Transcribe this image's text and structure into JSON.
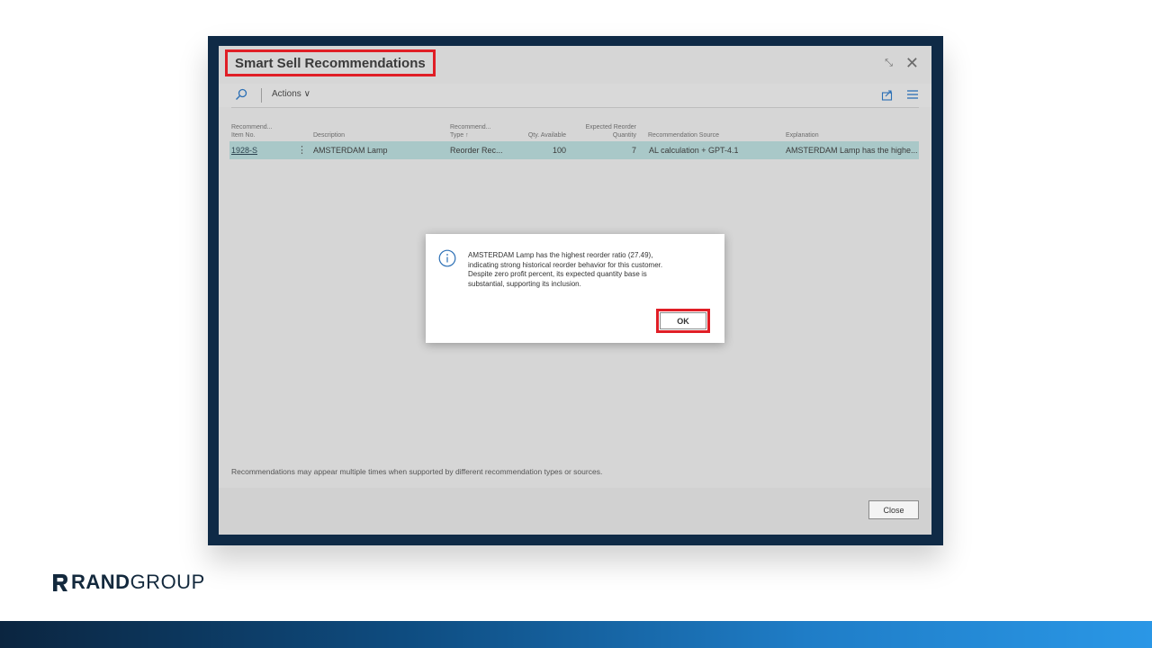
{
  "page": {
    "title": "Smart Sell Recommendations",
    "collapse_icon": "collapse-icon",
    "close_icon": "close-icon"
  },
  "toolbar": {
    "search_icon": "search-icon",
    "actions_label": "Actions ∨",
    "share_icon": "share-icon",
    "list_icon": "list-view-icon"
  },
  "columns": {
    "item_no": [
      "Recommend...",
      "Item No."
    ],
    "description": "Description",
    "type": [
      "Recommend...",
      "Type ↑"
    ],
    "qty_available": "Qty. Available",
    "expected_qty": [
      "Expected Reorder",
      "Quantity"
    ],
    "source": "Recommendation Source",
    "explanation": "Explanation"
  },
  "rows": [
    {
      "item_no": "1928-S",
      "description": "AMSTERDAM Lamp",
      "type": "Reorder Rec...",
      "qty_available": "100",
      "expected_qty": "7",
      "source": "AL calculation + GPT-4.1",
      "explanation": "AMSTERDAM Lamp has the highe..."
    }
  ],
  "dialog": {
    "icon": "info-icon",
    "lines": [
      "AMSTERDAM Lamp has the highest reorder ratio (27.49),",
      "indicating strong historical reorder behavior for this customer.",
      "Despite zero profit percent, its expected quantity base is",
      "substantial, supporting its inclusion."
    ],
    "ok_label": "OK"
  },
  "footnote": "Recommendations may appear multiple times when supported by different recommendation types or sources.",
  "footer": {
    "close_label": "Close"
  },
  "brand": {
    "bold": "RAND",
    "light": "GROUP",
    "colors": {
      "navy": "#13293d",
      "highlight_red": "#e01e26",
      "selected_row": "#a9c8c8"
    }
  }
}
